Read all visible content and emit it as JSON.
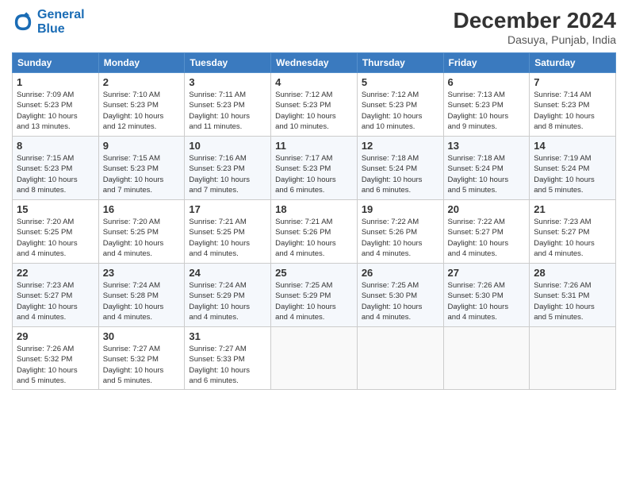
{
  "logo": {
    "line1": "General",
    "line2": "Blue"
  },
  "title": "December 2024",
  "location": "Dasuya, Punjab, India",
  "days_of_week": [
    "Sunday",
    "Monday",
    "Tuesday",
    "Wednesday",
    "Thursday",
    "Friday",
    "Saturday"
  ],
  "weeks": [
    [
      {
        "day": 1,
        "info": "Sunrise: 7:09 AM\nSunset: 5:23 PM\nDaylight: 10 hours\nand 13 minutes."
      },
      {
        "day": 2,
        "info": "Sunrise: 7:10 AM\nSunset: 5:23 PM\nDaylight: 10 hours\nand 12 minutes."
      },
      {
        "day": 3,
        "info": "Sunrise: 7:11 AM\nSunset: 5:23 PM\nDaylight: 10 hours\nand 11 minutes."
      },
      {
        "day": 4,
        "info": "Sunrise: 7:12 AM\nSunset: 5:23 PM\nDaylight: 10 hours\nand 10 minutes."
      },
      {
        "day": 5,
        "info": "Sunrise: 7:12 AM\nSunset: 5:23 PM\nDaylight: 10 hours\nand 10 minutes."
      },
      {
        "day": 6,
        "info": "Sunrise: 7:13 AM\nSunset: 5:23 PM\nDaylight: 10 hours\nand 9 minutes."
      },
      {
        "day": 7,
        "info": "Sunrise: 7:14 AM\nSunset: 5:23 PM\nDaylight: 10 hours\nand 8 minutes."
      }
    ],
    [
      {
        "day": 8,
        "info": "Sunrise: 7:15 AM\nSunset: 5:23 PM\nDaylight: 10 hours\nand 8 minutes."
      },
      {
        "day": 9,
        "info": "Sunrise: 7:15 AM\nSunset: 5:23 PM\nDaylight: 10 hours\nand 7 minutes."
      },
      {
        "day": 10,
        "info": "Sunrise: 7:16 AM\nSunset: 5:23 PM\nDaylight: 10 hours\nand 7 minutes."
      },
      {
        "day": 11,
        "info": "Sunrise: 7:17 AM\nSunset: 5:23 PM\nDaylight: 10 hours\nand 6 minutes."
      },
      {
        "day": 12,
        "info": "Sunrise: 7:18 AM\nSunset: 5:24 PM\nDaylight: 10 hours\nand 6 minutes."
      },
      {
        "day": 13,
        "info": "Sunrise: 7:18 AM\nSunset: 5:24 PM\nDaylight: 10 hours\nand 5 minutes."
      },
      {
        "day": 14,
        "info": "Sunrise: 7:19 AM\nSunset: 5:24 PM\nDaylight: 10 hours\nand 5 minutes."
      }
    ],
    [
      {
        "day": 15,
        "info": "Sunrise: 7:20 AM\nSunset: 5:25 PM\nDaylight: 10 hours\nand 4 minutes."
      },
      {
        "day": 16,
        "info": "Sunrise: 7:20 AM\nSunset: 5:25 PM\nDaylight: 10 hours\nand 4 minutes."
      },
      {
        "day": 17,
        "info": "Sunrise: 7:21 AM\nSunset: 5:25 PM\nDaylight: 10 hours\nand 4 minutes."
      },
      {
        "day": 18,
        "info": "Sunrise: 7:21 AM\nSunset: 5:26 PM\nDaylight: 10 hours\nand 4 minutes."
      },
      {
        "day": 19,
        "info": "Sunrise: 7:22 AM\nSunset: 5:26 PM\nDaylight: 10 hours\nand 4 minutes."
      },
      {
        "day": 20,
        "info": "Sunrise: 7:22 AM\nSunset: 5:27 PM\nDaylight: 10 hours\nand 4 minutes."
      },
      {
        "day": 21,
        "info": "Sunrise: 7:23 AM\nSunset: 5:27 PM\nDaylight: 10 hours\nand 4 minutes."
      }
    ],
    [
      {
        "day": 22,
        "info": "Sunrise: 7:23 AM\nSunset: 5:27 PM\nDaylight: 10 hours\nand 4 minutes."
      },
      {
        "day": 23,
        "info": "Sunrise: 7:24 AM\nSunset: 5:28 PM\nDaylight: 10 hours\nand 4 minutes."
      },
      {
        "day": 24,
        "info": "Sunrise: 7:24 AM\nSunset: 5:29 PM\nDaylight: 10 hours\nand 4 minutes."
      },
      {
        "day": 25,
        "info": "Sunrise: 7:25 AM\nSunset: 5:29 PM\nDaylight: 10 hours\nand 4 minutes."
      },
      {
        "day": 26,
        "info": "Sunrise: 7:25 AM\nSunset: 5:30 PM\nDaylight: 10 hours\nand 4 minutes."
      },
      {
        "day": 27,
        "info": "Sunrise: 7:26 AM\nSunset: 5:30 PM\nDaylight: 10 hours\nand 4 minutes."
      },
      {
        "day": 28,
        "info": "Sunrise: 7:26 AM\nSunset: 5:31 PM\nDaylight: 10 hours\nand 5 minutes."
      }
    ],
    [
      {
        "day": 29,
        "info": "Sunrise: 7:26 AM\nSunset: 5:32 PM\nDaylight: 10 hours\nand 5 minutes."
      },
      {
        "day": 30,
        "info": "Sunrise: 7:27 AM\nSunset: 5:32 PM\nDaylight: 10 hours\nand 5 minutes."
      },
      {
        "day": 31,
        "info": "Sunrise: 7:27 AM\nSunset: 5:33 PM\nDaylight: 10 hours\nand 6 minutes."
      },
      null,
      null,
      null,
      null
    ]
  ]
}
